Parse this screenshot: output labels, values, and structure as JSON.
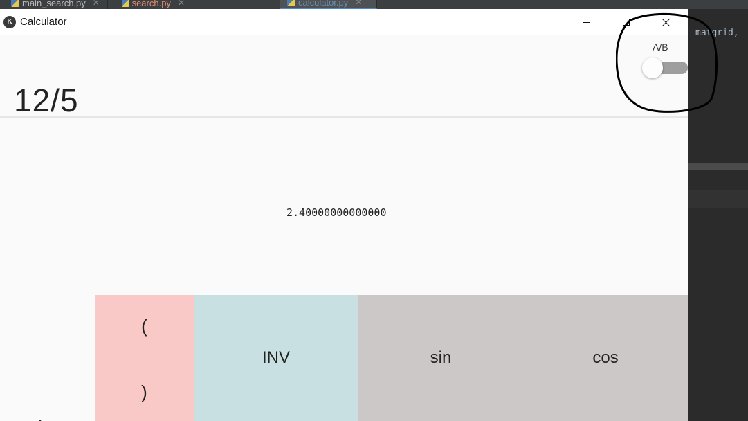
{
  "ide": {
    "tabs": [
      {
        "label": "main_search.py"
      },
      {
        "label": "search.py"
      },
      {
        "label": "calculator.py"
      }
    ],
    "tab_close_glyph": "✕",
    "code_snippet": "matgrid,"
  },
  "window": {
    "title": "Calculator",
    "app_icon_glyph": "K"
  },
  "display": {
    "expression": "12/5",
    "result": "2.40000000000000"
  },
  "toggle": {
    "label": "A/B",
    "state": "off"
  },
  "keypad": {
    "paren_open": "(",
    "paren_close": ")",
    "inv": "INV",
    "sin": "sin",
    "cos": "cos",
    "back_glyph": "‹"
  },
  "colors": {
    "paren_key": "#f8c9c6",
    "inv_key": "#c9e0e2",
    "trig_key": "#cdc8c8",
    "toggle_track": "#9e9e9e",
    "annotation_stroke": "#000000"
  }
}
